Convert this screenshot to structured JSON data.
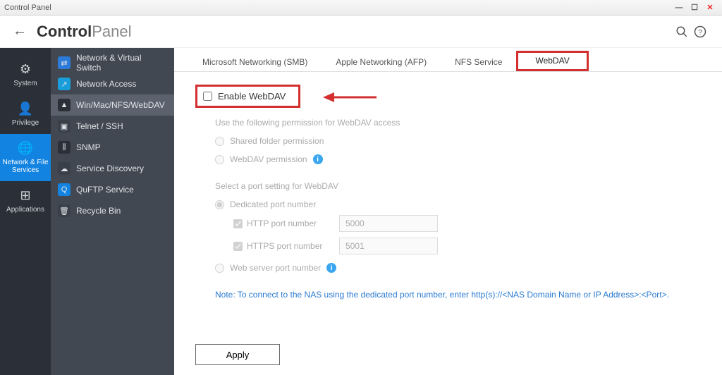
{
  "window": {
    "title": "Control Panel"
  },
  "header": {
    "title_bold": "Control",
    "title_light": "Panel"
  },
  "navrail": [
    {
      "icon": "⚙",
      "label": "System"
    },
    {
      "icon": "👤",
      "label": "Privilege"
    },
    {
      "icon": "🌐",
      "label": "Network & File Services"
    },
    {
      "icon": "⊞",
      "label": "Applications"
    }
  ],
  "sidelist": [
    {
      "label": "Network & Virtual Switch",
      "color": "#2d7bd8"
    },
    {
      "label": "Network Access",
      "color": "#1a9edb"
    },
    {
      "label": "Win/Mac/NFS/WebDAV",
      "color": "#2a2f38"
    },
    {
      "label": "Telnet / SSH",
      "color": "#3a4049"
    },
    {
      "label": "SNMP",
      "color": "#2a2f38"
    },
    {
      "label": "Service Discovery",
      "color": "#3a4049"
    },
    {
      "label": "QuFTP Service",
      "color": "#1283e0"
    },
    {
      "label": "Recycle Bin",
      "color": "#3a4049"
    }
  ],
  "tabs": [
    {
      "label": "Microsoft Networking (SMB)"
    },
    {
      "label": "Apple Networking (AFP)"
    },
    {
      "label": "NFS Service"
    },
    {
      "label": "WebDAV"
    }
  ],
  "form": {
    "enable_label": "Enable WebDAV",
    "perm_heading": "Use the following permission for WebDAV access",
    "perm_shared": "Shared folder permission",
    "perm_webdav": "WebDAV permission",
    "port_heading": "Select a port setting for WebDAV",
    "port_dedicated": "Dedicated port number",
    "http_label": "HTTP port number",
    "http_value": "5000",
    "https_label": "HTTPS port number",
    "https_value": "5001",
    "webserver_label": "Web server port number",
    "note": "Note: To connect to the NAS using the dedicated port number, enter http(s)://<NAS Domain Name or IP Address>:<Port>.",
    "apply": "Apply"
  }
}
